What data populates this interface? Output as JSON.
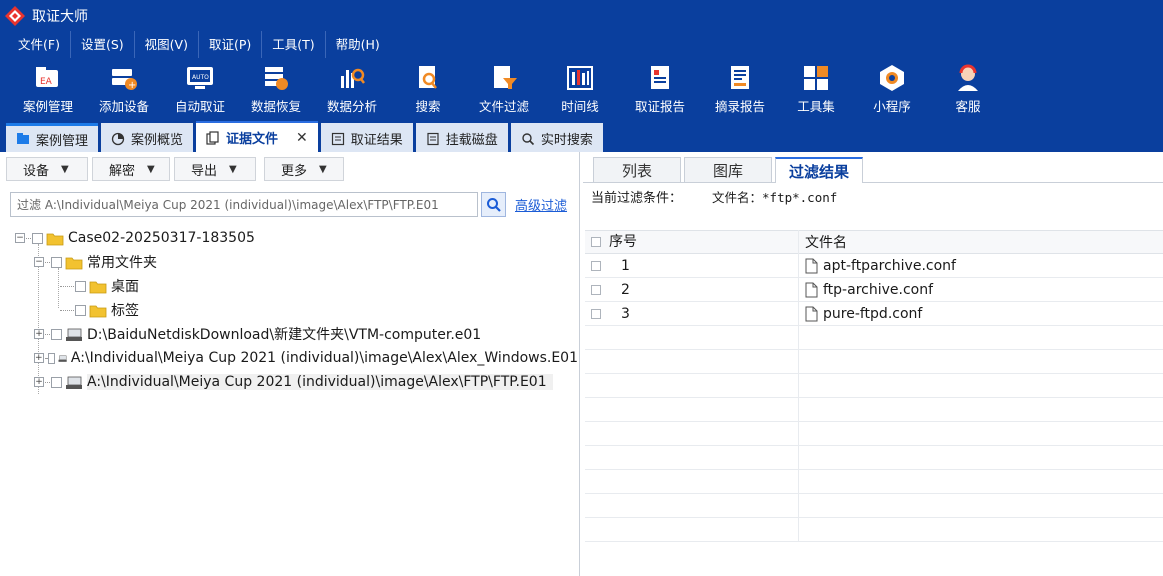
{
  "window": {
    "title": "取证大师"
  },
  "menu": [
    "文件(F)",
    "设置(S)",
    "视图(V)",
    "取证(P)",
    "工具(T)",
    "帮助(H)"
  ],
  "toolbar": [
    {
      "label": "案例管理",
      "icon": "case-management-icon"
    },
    {
      "label": "添加设备",
      "icon": "add-device-icon"
    },
    {
      "label": "自动取证",
      "icon": "auto-forensics-icon"
    },
    {
      "label": "数据恢复",
      "icon": "data-recovery-icon"
    },
    {
      "label": "数据分析",
      "icon": "data-analysis-icon"
    },
    {
      "label": "搜索",
      "icon": "search-doc-icon"
    },
    {
      "label": "文件过滤",
      "icon": "file-filter-icon"
    },
    {
      "label": "时间线",
      "icon": "timeline-icon"
    },
    {
      "label": "取证报告",
      "icon": "forensic-report-icon"
    },
    {
      "label": "摘录报告",
      "icon": "excerpt-report-icon"
    },
    {
      "label": "工具集",
      "icon": "toolset-icon"
    },
    {
      "label": "小程序",
      "icon": "mini-program-icon"
    },
    {
      "label": "客服",
      "icon": "customer-service-icon"
    }
  ],
  "tabs": [
    {
      "label": "案例管理",
      "active": false
    },
    {
      "label": "案例概览",
      "active": false
    },
    {
      "label": "证据文件",
      "active": true,
      "close": "✕"
    },
    {
      "label": "取证结果",
      "active": false
    },
    {
      "label": "挂载磁盘",
      "active": false
    },
    {
      "label": "实时搜索",
      "active": false
    }
  ],
  "left": {
    "buttons": [
      "设备",
      "解密",
      "导出",
      "更多"
    ],
    "filter_value": "过滤 A:\\Individual\\Meiya Cup 2021 (individual)\\image\\Alex\\FTP\\FTP.E01",
    "advanced_filter": "高级过滤",
    "tree": [
      {
        "label": "Case02-20250317-183505",
        "level": 0,
        "type": "folder",
        "expander": "−"
      },
      {
        "label": "常用文件夹",
        "level": 1,
        "type": "folder",
        "expander": "−"
      },
      {
        "label": "桌面",
        "level": 2,
        "type": "folder",
        "expander": ""
      },
      {
        "label": "标签",
        "level": 2,
        "type": "folder",
        "expander": ""
      },
      {
        "label": "D:\\BaiduNetdiskDownload\\新建文件夹\\VTM-computer.e01",
        "level": 1,
        "type": "disk",
        "expander": "+"
      },
      {
        "label": "A:\\Individual\\Meiya Cup 2021 (individual)\\image\\Alex\\Alex_Windows.E01",
        "level": 1,
        "type": "disk",
        "expander": "+"
      },
      {
        "label": "A:\\Individual\\Meiya Cup 2021 (individual)\\image\\Alex\\FTP\\FTP.E01",
        "level": 1,
        "type": "disk",
        "expander": "+",
        "selected": true
      }
    ]
  },
  "right": {
    "tabs": [
      {
        "label": "列表",
        "active": false
      },
      {
        "label": "图库",
        "active": false
      },
      {
        "label": "过滤结果",
        "active": true
      }
    ],
    "condition_label": "当前过滤条件：",
    "condition_value": "文件名：*ftp*.conf",
    "columns": [
      "序号",
      "文件名"
    ],
    "rows": [
      {
        "num": "1",
        "name": "apt-ftparchive.conf"
      },
      {
        "num": "2",
        "name": "ftp-archive.conf"
      },
      {
        "num": "3",
        "name": "pure-ftpd.conf"
      }
    ]
  },
  "colors": {
    "brand": "#0a3f9e",
    "accent": "#2a6de0",
    "folder": "#f2c230"
  }
}
